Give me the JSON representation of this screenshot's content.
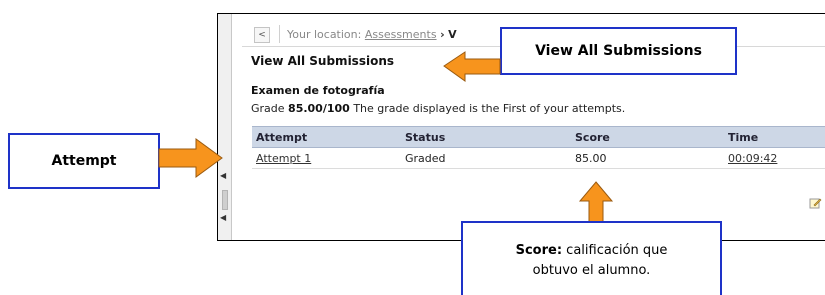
{
  "breadcrumb": {
    "back_icon": "chevron-left-icon",
    "prefix": "Your location:",
    "link": "Assessments",
    "arrow": "›",
    "current": "V"
  },
  "page": {
    "title": "View All Submissions",
    "test_name": "Examen de fotografía",
    "grade_label": "Grade",
    "grade_value": "85.00/100",
    "grade_note": "The grade displayed is the First of your attempts."
  },
  "table": {
    "headers": [
      "Attempt",
      "Status",
      "Score",
      "Time"
    ],
    "rows": [
      {
        "attempt": "Attempt 1",
        "status": "Graded",
        "score": "85.00",
        "time": "00:09:42"
      }
    ]
  },
  "callouts": {
    "attempt": "Attempt",
    "view_all": "View All Submissions",
    "score_label": "Score:",
    "score_desc_1": "calificación que",
    "score_desc_2": "obtuvo el alumno."
  },
  "colors": {
    "callout_border": "#1e32c8",
    "arrow_fill": "#f7941d",
    "table_header": "#cdd7e6"
  }
}
